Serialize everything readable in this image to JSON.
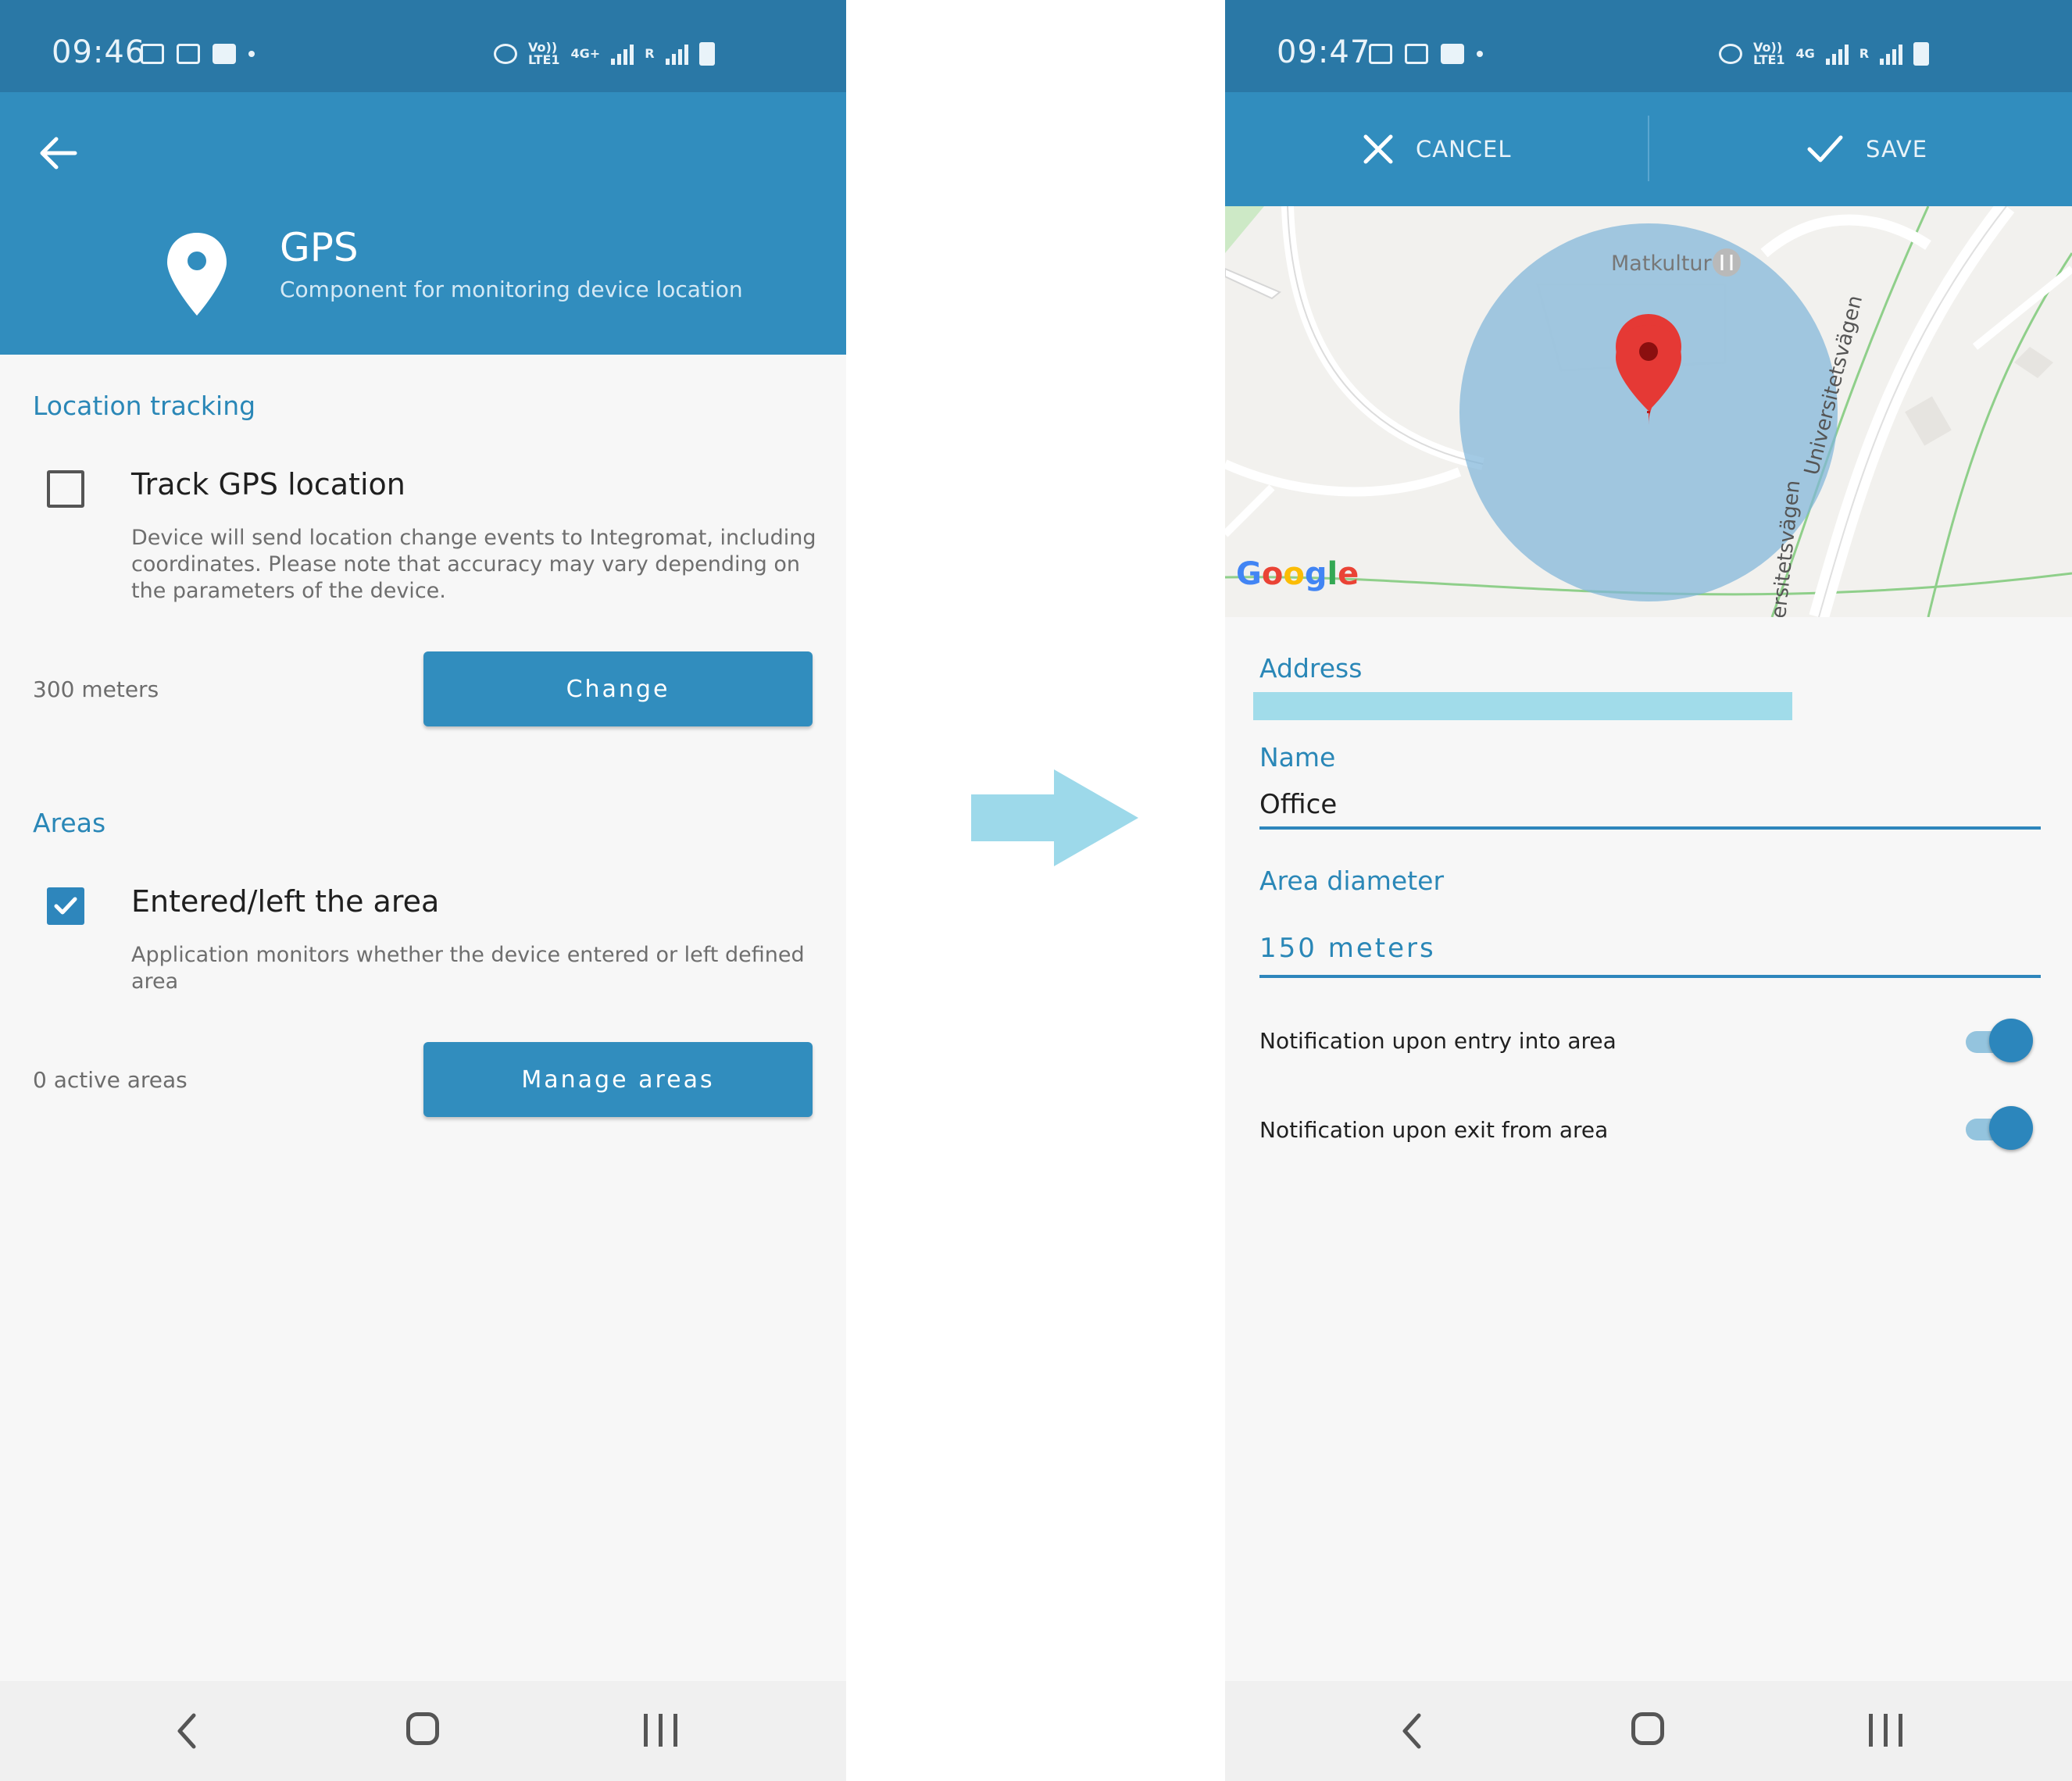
{
  "left_screen": {
    "status_bar": {
      "time": "09:46",
      "network_label_top": "Vo))",
      "network_label_bottom": "LTE1",
      "data_label": "4G+",
      "roaming_label": "R"
    },
    "header": {
      "title": "GPS",
      "subtitle": "Component for monitoring device location",
      "back_icon": "arrow-left-icon",
      "component_icon": "location-pin-icon"
    },
    "location_tracking": {
      "section_title": "Location tracking",
      "checkbox_checked": false,
      "title": "Track GPS location",
      "description": "Device will send location change events to Integromat, including coordinates. Please note that accuracy may vary depending on the parameters of the device.",
      "meta": "300 meters",
      "button_label": "Change"
    },
    "areas": {
      "section_title": "Areas",
      "checkbox_checked": true,
      "title": "Entered/left the area",
      "description": "Application monitors whether the device entered or left defined area",
      "meta": "0 active areas",
      "button_label": "Manage areas"
    }
  },
  "right_screen": {
    "status_bar": {
      "time": "09:47",
      "network_label_top": "Vo))",
      "network_label_bottom": "LTE1",
      "data_label": "4G",
      "roaming_label": "R"
    },
    "header": {
      "cancel_label": "CANCEL",
      "save_label": "SAVE",
      "cancel_icon": "close-icon",
      "save_icon": "checkmark-icon"
    },
    "map": {
      "place_label": "Matkultur",
      "road_label_1": "Universitetsvägen",
      "road_label_2": "ersitetsvägen",
      "attribution": {
        "letters": [
          "G",
          "o",
          "o",
          "g",
          "l",
          "e"
        ],
        "colors": [
          "#4285F4",
          "#EA4335",
          "#FBBC05",
          "#4285F4",
          "#34A853",
          "#EA4335"
        ]
      }
    },
    "form": {
      "address_label": "Address",
      "name_label": "Name",
      "name_value": "Office",
      "diameter_label": "Area diameter",
      "diameter_value": "150 meters",
      "toggles": [
        {
          "label": "Notification upon entry into area",
          "on": true
        },
        {
          "label": "Notification upon exit from area",
          "on": true
        }
      ]
    }
  },
  "colors": {
    "primary": "#318dbe",
    "status_bar": "#2a78a6",
    "accent_text": "#2a87b7",
    "arrow": "#9dd9ea",
    "address_highlight": "#a1dcea",
    "map_pin": "#e53935"
  }
}
